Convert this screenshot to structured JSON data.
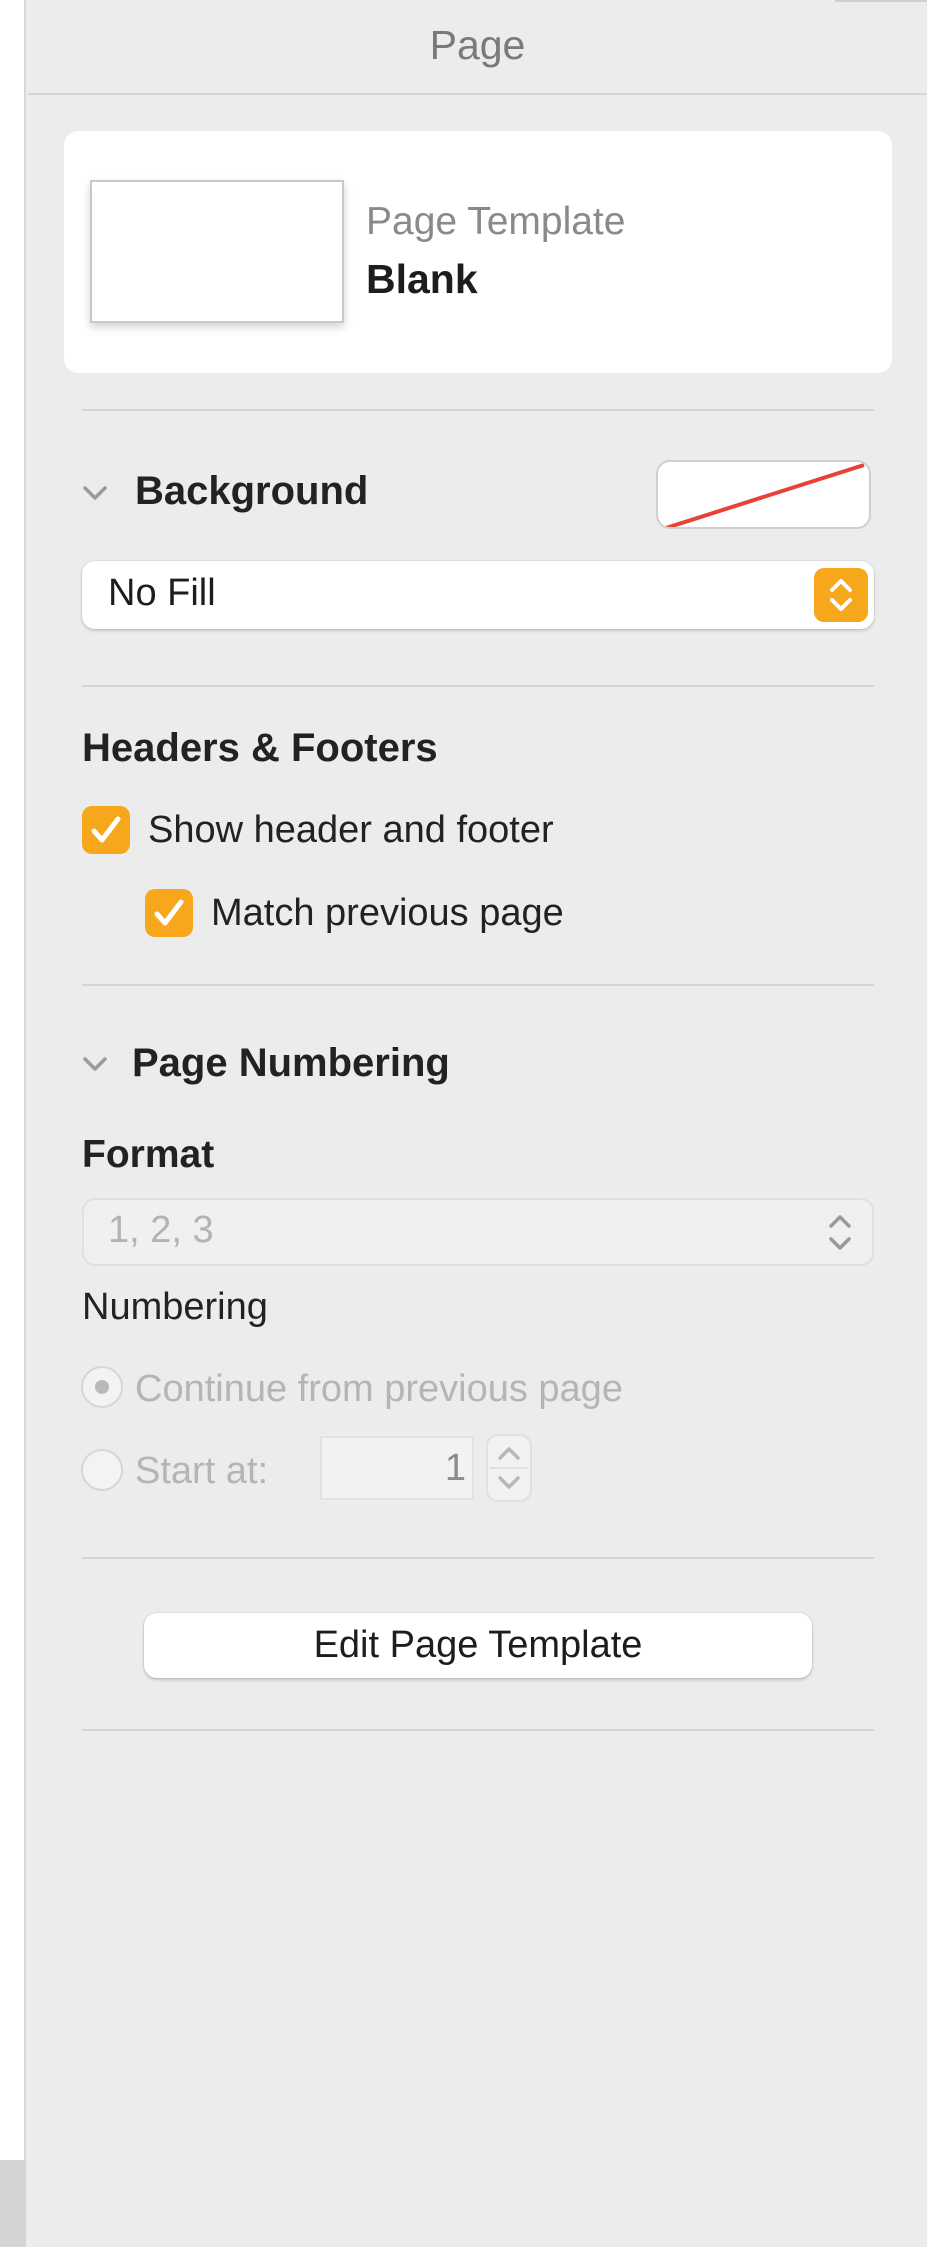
{
  "panel": {
    "title": "Page"
  },
  "template": {
    "label": "Page Template",
    "name": "Blank"
  },
  "background": {
    "heading": "Background",
    "fill": {
      "selected": "No Fill"
    },
    "swatch_state": "no-fill"
  },
  "headers_footers": {
    "heading": "Headers & Footers",
    "show_header_footer": {
      "label": "Show header and footer",
      "checked": true
    },
    "match_previous": {
      "label": "Match previous page",
      "checked": true
    }
  },
  "page_numbering": {
    "heading": "Page Numbering",
    "format_label": "Format",
    "format": {
      "selected": "1, 2, 3"
    },
    "numbering_label": "Numbering",
    "continue_option": {
      "label": "Continue from previous page",
      "selected": true
    },
    "start_option": {
      "label": "Start at:",
      "selected": false,
      "value": "1"
    }
  },
  "actions": {
    "edit_template": "Edit Page Template"
  },
  "colors": {
    "accent": "#f7a71b",
    "panel_bg": "#ececec",
    "divider": "#d3d3d3",
    "no_fill_line": "#e8413a"
  },
  "icons": {
    "collapse": "chevron-down-icon",
    "select_arrows": "up-down-chevron-icon",
    "check": "checkmark-icon"
  }
}
